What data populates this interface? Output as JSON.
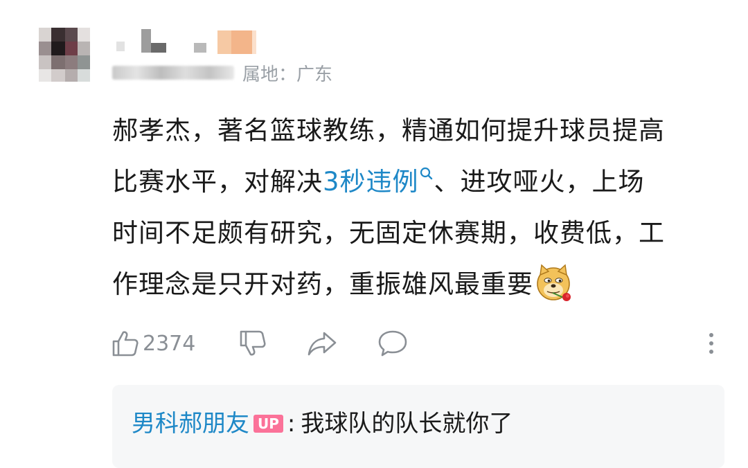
{
  "comment": {
    "location": "属地：广东",
    "text_lines": [
      [
        "郝孝杰，著名篮球教练，精通如何提升球员提高"
      ],
      [
        "比赛水平，对解决",
        "3秒违例",
        "、进攻哑火，上场"
      ],
      [
        "时间不足颇有研究，无固定休赛期，收费低，工"
      ],
      [
        "作理念是只开对药，重振雄风最重要"
      ]
    ],
    "line1": "郝孝杰，著名篮球教练，精通如何提升球员提高",
    "line2_before": "比赛水平，对解决",
    "line2_link": "3秒违例",
    "line2_after": "、进攻哑火，上场",
    "line3": "时间不足颇有研究，无固定休赛期，收费低，工",
    "line4": "作理念是只开对药，重振雄风最重要",
    "emoji": "doge-rose-icon"
  },
  "actions": {
    "like_count": "2374",
    "icons": [
      "thumbs-up-icon",
      "thumbs-down-icon",
      "share-icon",
      "comment-icon",
      "more-vertical-icon"
    ]
  },
  "reply": {
    "author": "男科郝朋友",
    "badge": "UP",
    "separator": ":",
    "text": "我球队的队长就你了"
  },
  "colors": {
    "link": "#1e88c7",
    "up_badge": "#fb7299",
    "muted": "#8a8f95",
    "reply_bg": "#f6f7f8"
  }
}
